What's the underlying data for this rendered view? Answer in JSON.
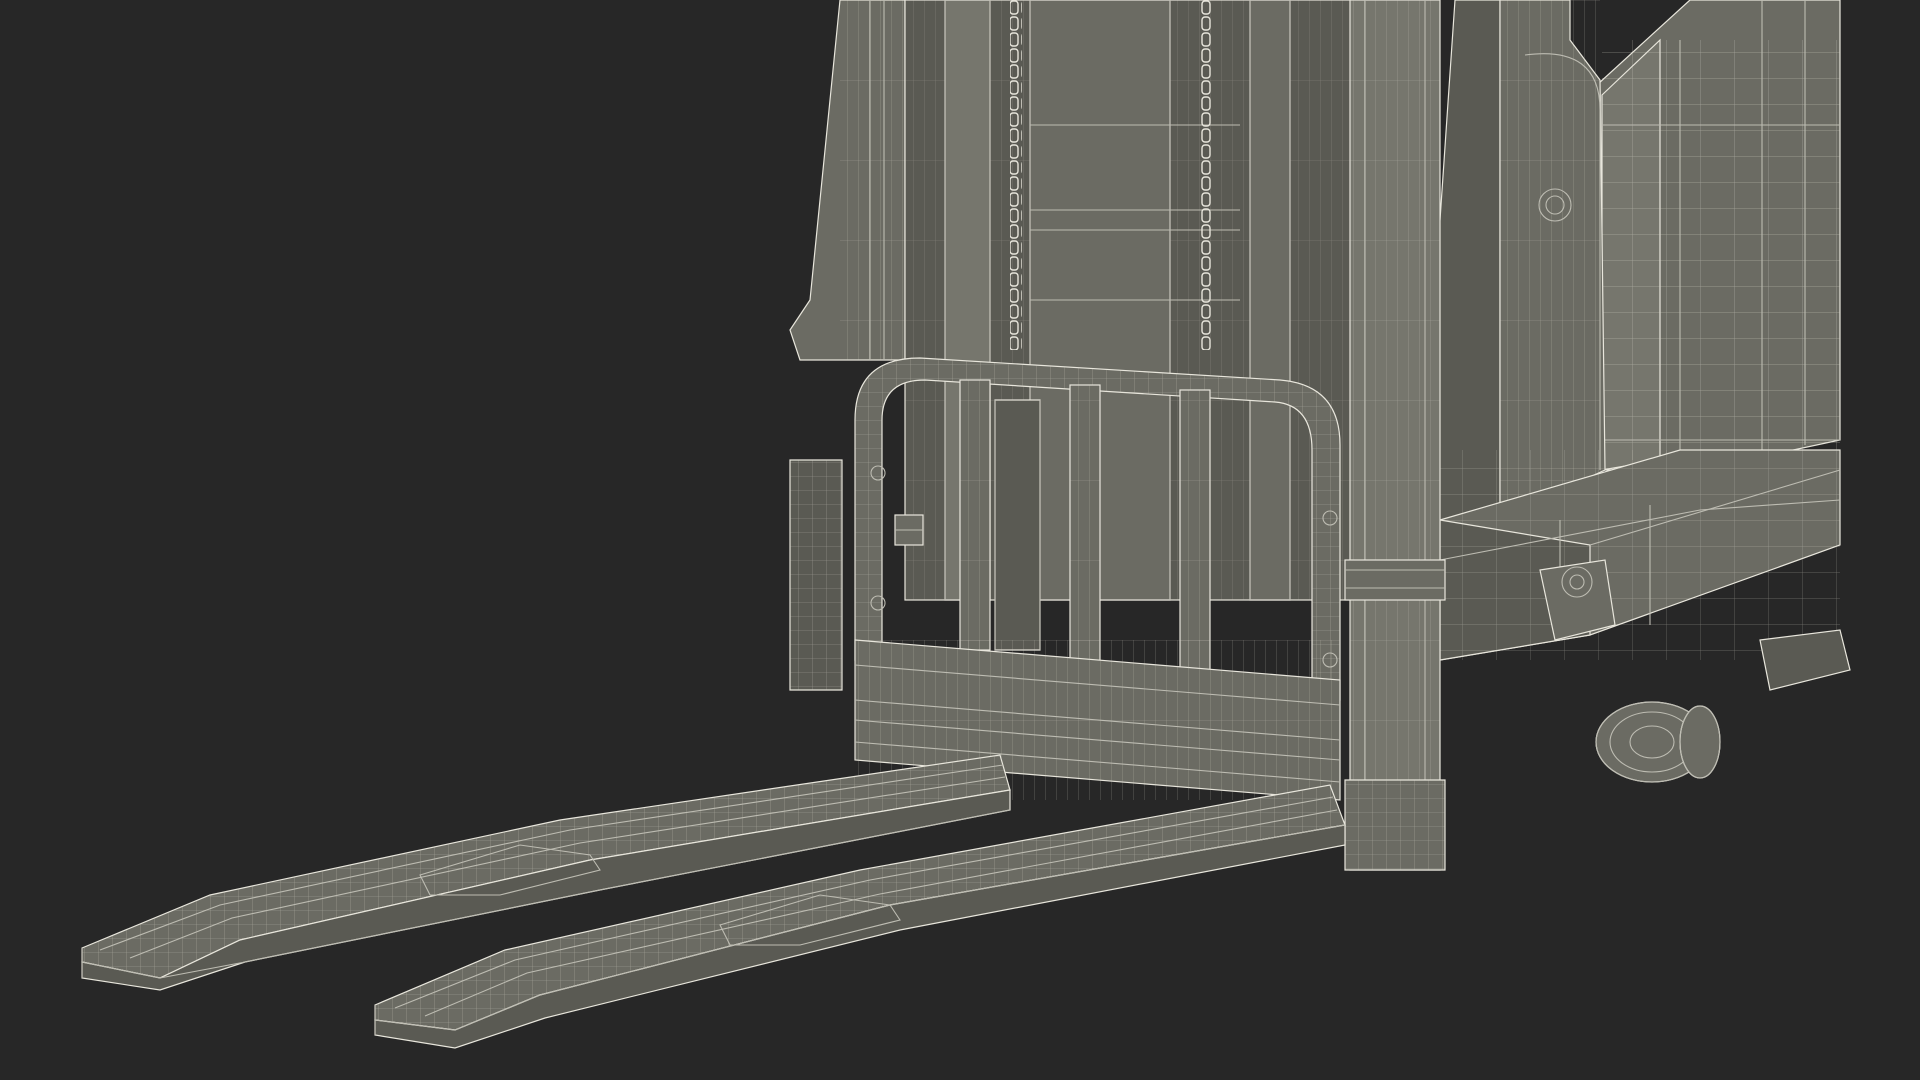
{
  "scene": {
    "subject": "forklift-pallet-stacker-wireframe",
    "colors": {
      "background": "#272727",
      "surface": "#6b6b63",
      "surface_light": "#76766d",
      "surface_dark": "#5a5a53",
      "wire": "#e8e6dc",
      "wire_dim": "#bdbcb2"
    }
  }
}
